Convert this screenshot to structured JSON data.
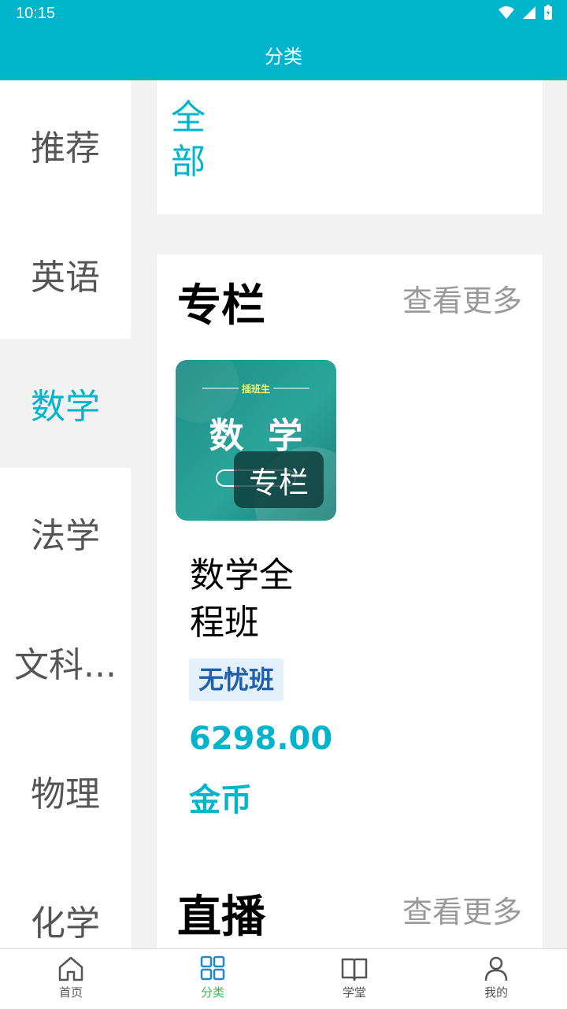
{
  "status": {
    "time": "10:15"
  },
  "header": {
    "title": "分类"
  },
  "sidebar": {
    "items": [
      {
        "label": "推荐"
      },
      {
        "label": "英语"
      },
      {
        "label": "数学"
      },
      {
        "label": "法学"
      },
      {
        "label": "文科..."
      },
      {
        "label": "物理"
      },
      {
        "label": "化学"
      }
    ],
    "active_index": 2
  },
  "tags": {
    "all": "全部"
  },
  "column_section": {
    "title": "专栏",
    "more": "查看更多",
    "course": {
      "cover_brand": "插班生",
      "cover_title": "数  学",
      "cover_tag": "专栏",
      "title": "数学全程班",
      "badge": "无忧班",
      "price": "6298.00",
      "unit": "金币"
    }
  },
  "live_section": {
    "title": "直播",
    "more": "查看更多"
  },
  "nav": {
    "items": [
      {
        "label": "首页",
        "icon": "home-icon"
      },
      {
        "label": "分类",
        "icon": "grid-icon"
      },
      {
        "label": "学堂",
        "icon": "book-icon"
      },
      {
        "label": "我的",
        "icon": "user-icon"
      }
    ],
    "active_index": 1
  },
  "colors": {
    "accent": "#00b4cc",
    "nav_active": "#3cb94f"
  }
}
